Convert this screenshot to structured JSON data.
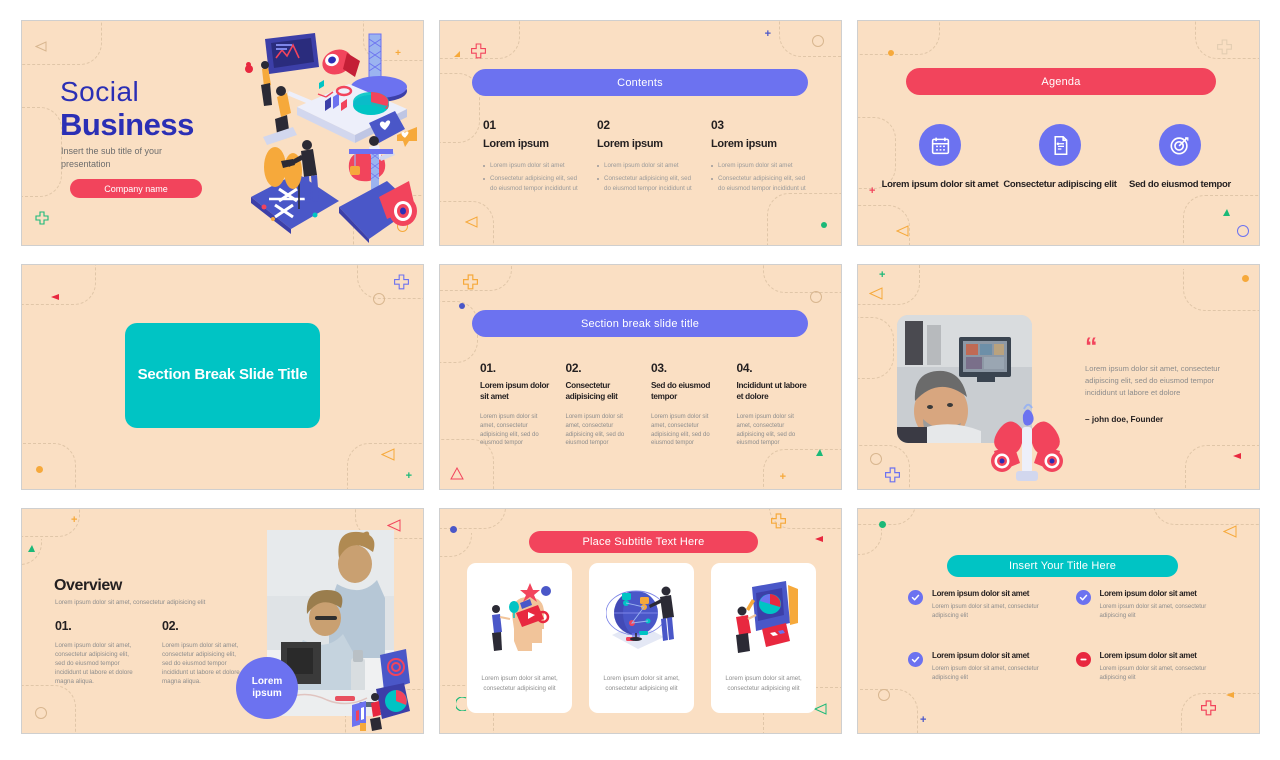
{
  "theme": {
    "slide_bg": "#FADFC3",
    "page_bg": "#FFFFFF",
    "blue": "#6C72F0",
    "indigo": "#2B2FB5",
    "red": "#F2445C",
    "teal": "#00C4C4",
    "dark": "#231F20",
    "muted": "#8D8D8D"
  },
  "slide1": {
    "title_light": "Social",
    "title_bold": "Business",
    "subtitle": "Insert the sub title of your presentation",
    "button_label": "Company name"
  },
  "slide2": {
    "banner": "Contents",
    "columns": [
      {
        "number": "01",
        "heading": "Lorem ipsum",
        "bullets": [
          "Lorem ipsum dolor sit amet",
          "Consectetur adipisicing elit, sed do eiusmod tempor incididunt ut"
        ]
      },
      {
        "number": "02",
        "heading": "Lorem ipsum",
        "bullets": [
          "Lorem ipsum dolor sit amet",
          "Consectetur adipisicing elit, sed do eiusmod tempor incididunt ut"
        ]
      },
      {
        "number": "03",
        "heading": "Lorem ipsum",
        "bullets": [
          "Lorem ipsum dolor sit amet",
          "Consectetur adipisicing elit, sed do eiusmod tempor incididunt ut"
        ]
      }
    ]
  },
  "slide3": {
    "banner": "Agenda",
    "items": [
      {
        "icon": "calendar-icon",
        "label": "Lorem ipsum dolor sit amet"
      },
      {
        "icon": "document-list-icon",
        "label": "Consectetur adipiscing elit"
      },
      {
        "icon": "target-icon",
        "label": "Sed do eiusmod tempor"
      }
    ]
  },
  "slide4": {
    "title": "Section Break Slide Title"
  },
  "slide5": {
    "banner": "Section break slide title",
    "columns": [
      {
        "number": "01.",
        "heading": "Lorem ipsum dolor sit amet",
        "body": "Lorem ipsum dolor sit amet, consectetur adipisicing elit, sed do eiusmod tempor"
      },
      {
        "number": "02.",
        "heading": "Consectetur adipisicing elit",
        "body": "Lorem ipsum dolor sit amet, consectetur adipisicing elit, sed do eiusmod tempor"
      },
      {
        "number": "03.",
        "heading": "Sed do eiusmod tempor",
        "body": "Lorem ipsum dolor sit amet, consectetur adipisicing elit, sed do eiusmod tempor"
      },
      {
        "number": "04.",
        "heading": "Incididunt ut labore et dolore",
        "body": "Lorem ipsum dolor sit amet, consectetur adipisicing elit, sed do eiusmod tempor"
      }
    ]
  },
  "slide6": {
    "quote_mark": "“",
    "quote": "Lorem ipsum dolor sit amet, consectetur adipiscing elit, sed do eiusmod tempor incididunt ut labore et dolore",
    "author": "– john doe, Founder"
  },
  "slide7": {
    "title": "Overview",
    "subtitle": "Lorem ipsum dolor sit amet, consectetur adipisicing elit",
    "columns": [
      {
        "number": "01.",
        "body": "Lorem ipsum dolor sit amet, consectetur adipisicing elit, sed do eiusmod tempor incididunt ut labore et dolore magna aliqua."
      },
      {
        "number": "02.",
        "body": "Lorem ipsum dolor sit amet, consectetur adipisicing elit, sed do eiusmod tempor incididunt ut labore et dolore magna aliqua."
      }
    ],
    "badge_label": "Lorem ipsum"
  },
  "slide8": {
    "banner": "Place Subtitle Text Here",
    "cards": [
      {
        "illustration": "mind-media-illustration",
        "caption": "Lorem ipsum dolor sit amet, consectetur adipisicing elit"
      },
      {
        "illustration": "globe-network-illustration",
        "caption": "Lorem ipsum dolor sit amet, consectetur adipisicing elit"
      },
      {
        "illustration": "dashboard-screens-illustration",
        "caption": "Lorem ipsum dolor sit amet, consectetur adipisicing elit"
      }
    ]
  },
  "slide9": {
    "banner": "Insert Your Title Here",
    "items": [
      {
        "status": "check",
        "heading": "Lorem ipsum dolor sit amet",
        "body": "Lorem ipsum dolor sit amet, consectetur adipiscing elit"
      },
      {
        "status": "check",
        "heading": "Lorem ipsum dolor sit amet",
        "body": "Lorem ipsum dolor sit amet, consectetur adipiscing elit"
      },
      {
        "status": "check",
        "heading": "Lorem ipsum dolor sit amet",
        "body": "Lorem ipsum dolor sit amet, consectetur adipiscing elit"
      },
      {
        "status": "minus",
        "heading": "Lorem ipsum dolor sit amet",
        "body": "Lorem ipsum dolor sit amet, consectetur adipiscing elit"
      }
    ]
  }
}
